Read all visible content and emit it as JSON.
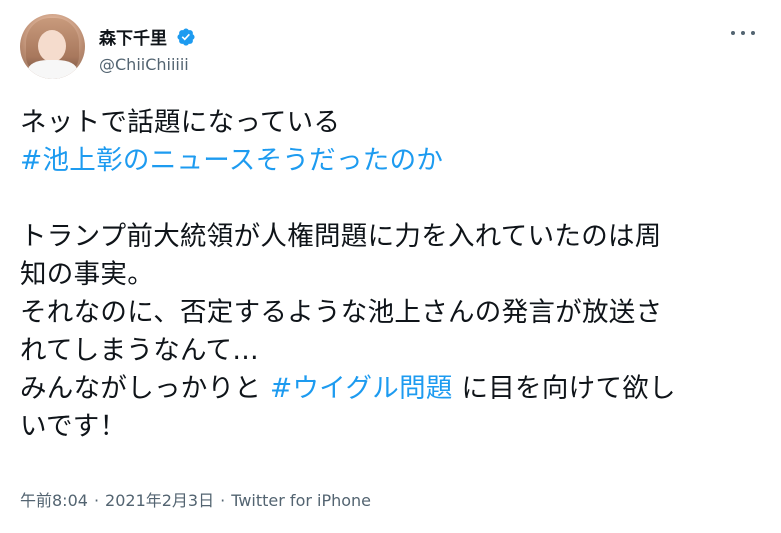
{
  "user": {
    "display_name": "森下千里",
    "handle": "@ChiiChiiiii"
  },
  "tweet": {
    "line1": "ネットで話題になっている",
    "hashtag1": "#池上彰のニュースそうだったのか",
    "line3": "トランプ前大統領が人権問題に力を入れていたのは周",
    "line4": "知の事実。",
    "line5": "それなのに、否定するような池上さんの発言が放送さ",
    "line6": "れてしまうなんて…",
    "line7_pre": "みんながしっかりと ",
    "hashtag2": "#ウイグル問題",
    "line7_post": " に目を向けて欲し",
    "line8": "いです！"
  },
  "meta": {
    "time": "午前8:04",
    "date": "2021年2月3日",
    "source": "Twitter for iPhone",
    "separator": "·"
  },
  "colors": {
    "link": "#1d9bf0",
    "verified": "#1d9bf0",
    "secondary_text": "#536471",
    "primary_text": "#0f1419"
  },
  "icons": {
    "verified": "verified-badge-icon",
    "more": "more-horizontal-icon"
  }
}
